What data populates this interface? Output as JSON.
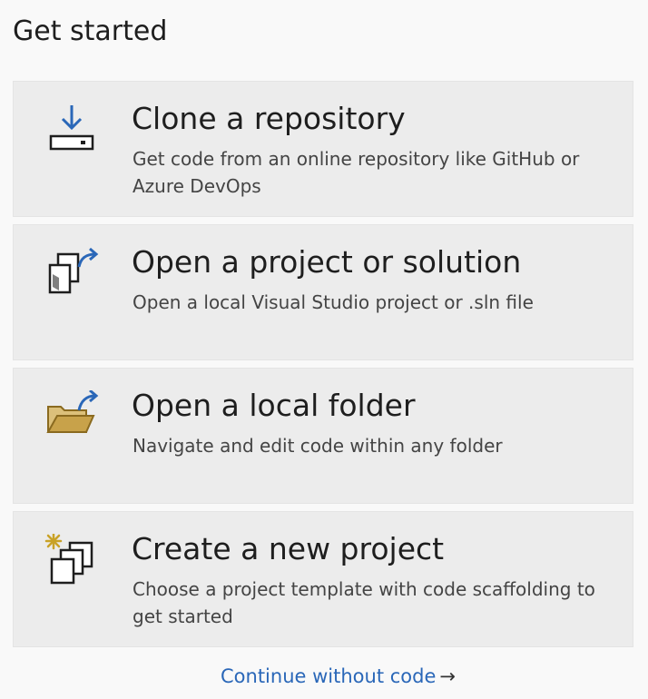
{
  "heading": "Get started",
  "cards": [
    {
      "title": "Clone a repository",
      "description": "Get code from an online repository like GitHub or Azure DevOps",
      "icon": "clone-download-icon"
    },
    {
      "title": "Open a project or solution",
      "description": "Open a local Visual Studio project or .sln file",
      "icon": "open-project-icon"
    },
    {
      "title": "Open a local folder",
      "description": "Navigate and edit code within any folder",
      "icon": "open-folder-icon"
    },
    {
      "title": "Create a new project",
      "description": "Choose a project template with code scaffolding to get started",
      "icon": "new-project-icon"
    }
  ],
  "continue_link": {
    "label": "Continue without code",
    "arrow": "→"
  },
  "colors": {
    "accent_blue": "#2a67b8",
    "folder_gold": "#c8a24a",
    "sparkle_gold": "#c9a227"
  }
}
